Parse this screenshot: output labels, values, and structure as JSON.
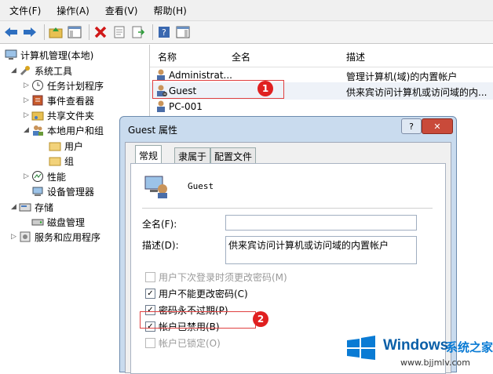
{
  "menu": [
    "文件(F)",
    "操作(A)",
    "查看(V)",
    "帮助(H)"
  ],
  "tree": {
    "root": "计算机管理(本地)",
    "system_tools": "系统工具",
    "task_scheduler": "任务计划程序",
    "event_viewer": "事件查看器",
    "shared_folders": "共享文件夹",
    "local_users": "本地用户和组",
    "users": "用户",
    "groups": "组",
    "performance": "性能",
    "device_manager": "设备管理器",
    "storage": "存储",
    "disk_management": "磁盘管理",
    "services": "服务和应用程序"
  },
  "list": {
    "headers": [
      "名称",
      "全名",
      "描述"
    ],
    "rows": [
      {
        "name": "Administrat...",
        "full": "",
        "desc": "管理计算机(域)的内置帐户"
      },
      {
        "name": "Guest",
        "full": "",
        "desc": "供来宾访问计算机或访问域的内..."
      },
      {
        "name": "PC-001",
        "full": "",
        "desc": ""
      }
    ]
  },
  "dialog": {
    "title": "Guest 属性",
    "help_btn": "?",
    "close_btn": "✕",
    "tabs": [
      "常规",
      "隶属于",
      "配置文件"
    ],
    "user_name": "Guest",
    "fullname_label": "全名(F):",
    "fullname_value": "",
    "desc_label": "描述(D):",
    "desc_value": "供来宾访问计算机或访问域的内置帐户",
    "options": [
      {
        "label": "用户下次登录时须更改密码(M)",
        "checked": false,
        "enabled": false
      },
      {
        "label": "用户不能更改密码(C)",
        "checked": true,
        "enabled": true
      },
      {
        "label": "密码永不过期(P)",
        "checked": true,
        "enabled": true
      },
      {
        "label": "帐户已禁用(B)",
        "checked": true,
        "enabled": true
      },
      {
        "label": "帐户已锁定(O)",
        "checked": false,
        "enabled": false
      }
    ]
  },
  "badges": [
    "1",
    "2"
  ],
  "watermark": {
    "brand": "Windows",
    "site_cn": "系统之家",
    "url": "www.bjjmlv.com"
  },
  "colors": {
    "badge": "#e02020",
    "dialog_frame": "#c9dbee",
    "wm_blue": "#0a7bd4"
  }
}
